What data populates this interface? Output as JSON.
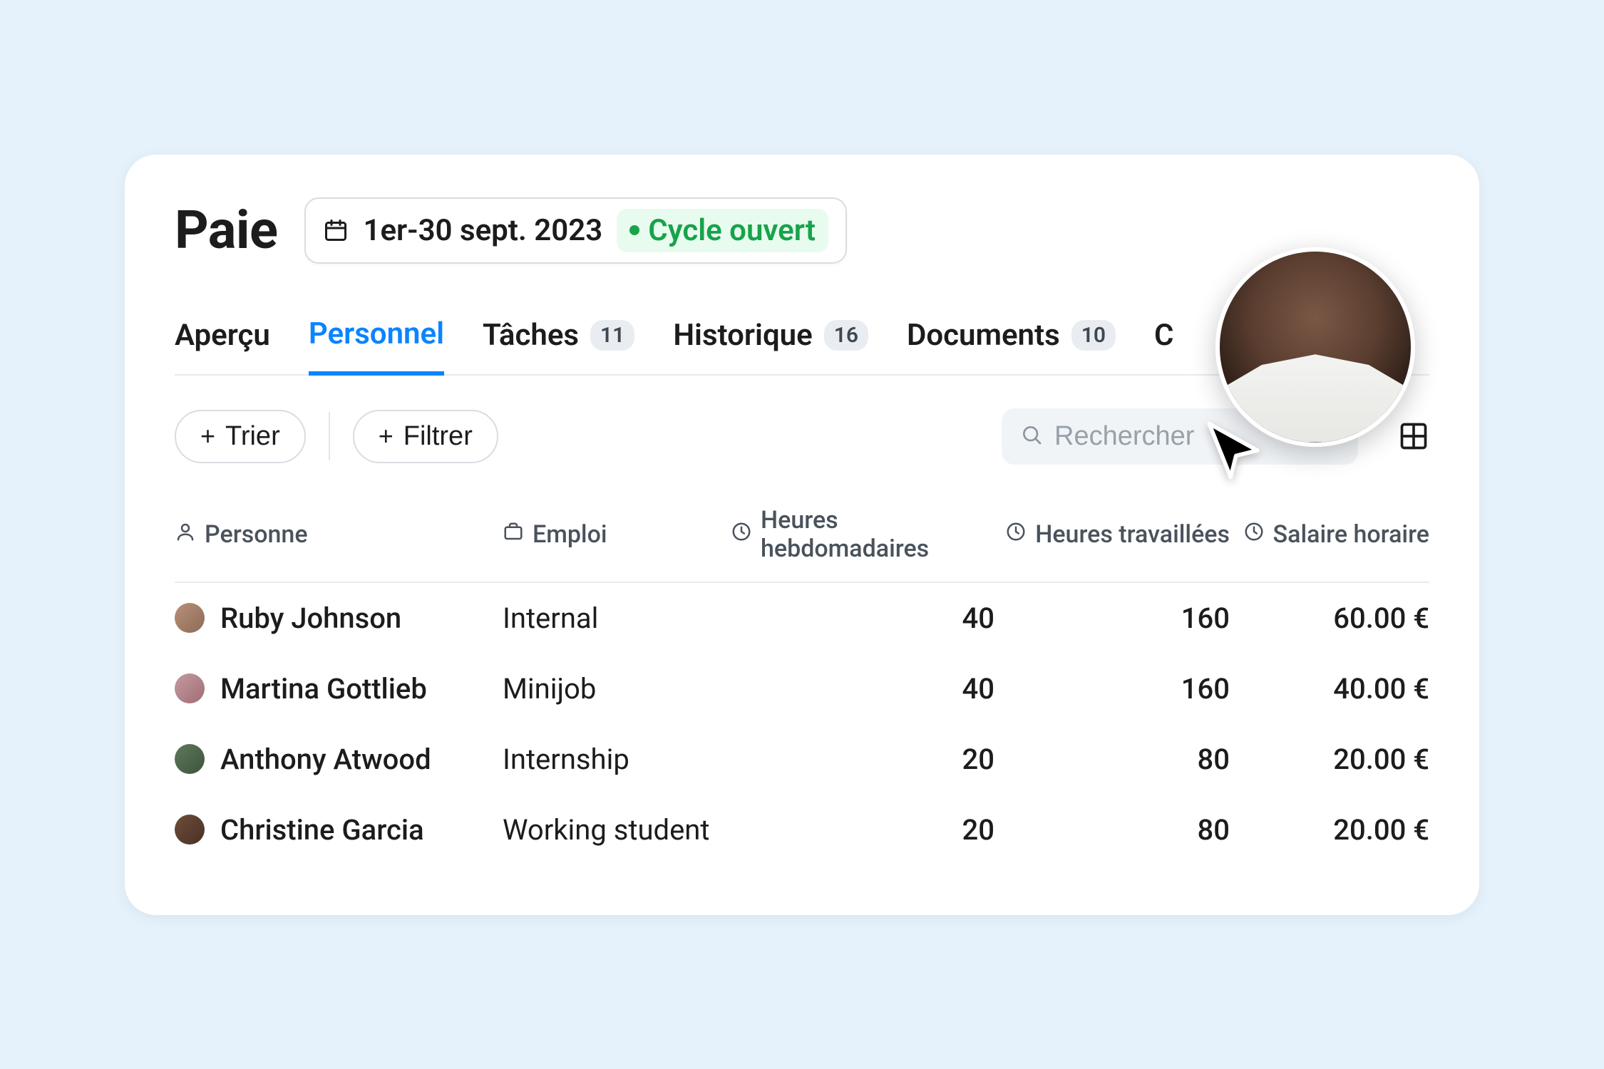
{
  "header": {
    "title": "Paie",
    "period": "1er-30 sept. 2023",
    "status_label": "Cycle ouvert"
  },
  "tabs": [
    {
      "label": "Aperçu",
      "badge": null,
      "active": false
    },
    {
      "label": "Personnel",
      "badge": null,
      "active": true
    },
    {
      "label": "Tâches",
      "badge": "11",
      "active": false
    },
    {
      "label": "Historique",
      "badge": "16",
      "active": false
    },
    {
      "label": "Documents",
      "badge": "10",
      "active": false
    },
    {
      "label": "C",
      "badge": null,
      "active": false,
      "truncated": true
    }
  ],
  "toolbar": {
    "sort_label": "Trier",
    "filter_label": "Filtrer",
    "search_placeholder": "Rechercher"
  },
  "columns": {
    "person": "Personne",
    "employment": "Emploi",
    "weekly_hours": "Heures hebdomadaires",
    "worked_hours": "Heures travaillées",
    "hourly_wage": "Salaire horaire"
  },
  "rows": [
    {
      "name": "Ruby Johnson",
      "employment": "Internal",
      "weekly_hours": "40",
      "worked_hours": "160",
      "hourly_wage": "60.00 €"
    },
    {
      "name": "Martina Gottlieb",
      "employment": "Minijob",
      "weekly_hours": "40",
      "worked_hours": "160",
      "hourly_wage": "40.00 €"
    },
    {
      "name": "Anthony Atwood",
      "employment": "Internship",
      "weekly_hours": "20",
      "worked_hours": "80",
      "hourly_wage": "20.00 €"
    },
    {
      "name": "Christine Garcia",
      "employment": "Working student",
      "weekly_hours": "20",
      "worked_hours": "80",
      "hourly_wage": "20.00 €"
    }
  ]
}
